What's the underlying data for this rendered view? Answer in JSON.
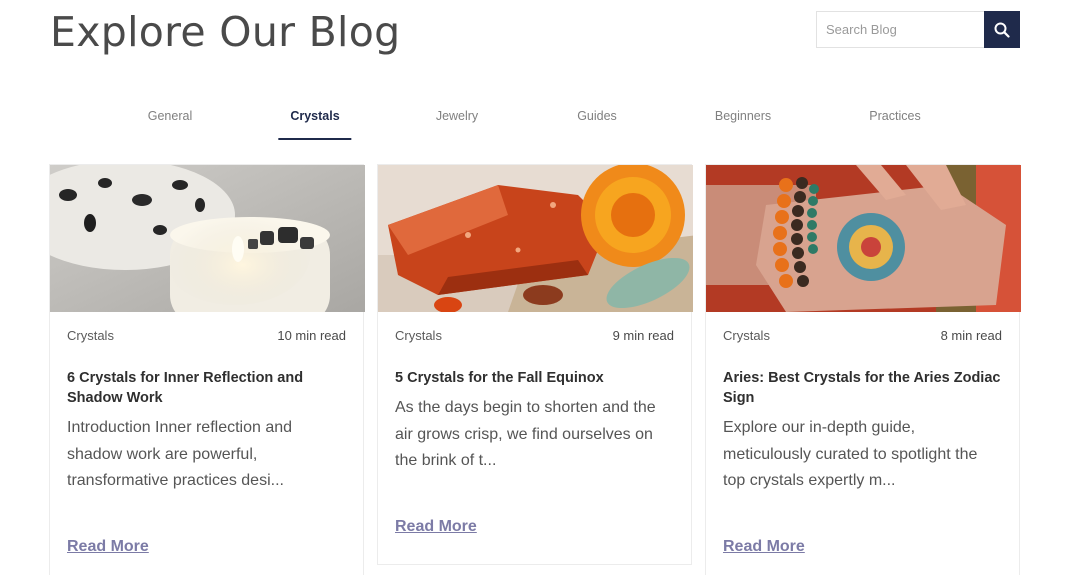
{
  "header": {
    "title": "Explore Our Blog"
  },
  "search": {
    "placeholder": "Search Blog",
    "icon": "search-icon"
  },
  "tabs": [
    {
      "label": "General",
      "active": false
    },
    {
      "label": "Crystals",
      "active": true
    },
    {
      "label": "Jewelry",
      "active": false
    },
    {
      "label": "Guides",
      "active": false
    },
    {
      "label": "Beginners",
      "active": false
    },
    {
      "label": "Practices",
      "active": false
    }
  ],
  "posts": [
    {
      "category": "Crystals",
      "read_time": "10 min read",
      "title": "6 Crystals for Inner Reflection and Shadow Work",
      "excerpt": "Introduction Inner reflection and shadow work are powerful, transformative practices desi...",
      "link": "Read More"
    },
    {
      "category": "Crystals",
      "read_time": "9 min read",
      "title": "5 Crystals for the Fall Equinox",
      "excerpt": "As the days begin to shorten and the air grows crisp, we find ourselves on the brink of t...",
      "link": "Read More"
    },
    {
      "category": "Crystals",
      "read_time": "8 min read",
      "title": "Aries: Best Crystals for the Aries Zodiac Sign",
      "excerpt": "Explore our in-depth guide, meticulously curated to spotlight the top crystals expertly m...",
      "link": "Read More"
    }
  ],
  "colors": {
    "accent": "#1f2a4b",
    "link": "#7c7ba6"
  }
}
